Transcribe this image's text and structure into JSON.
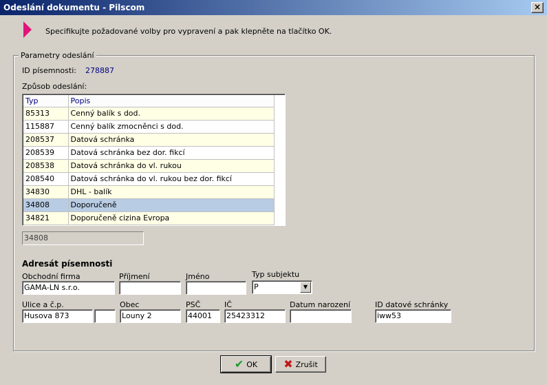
{
  "window": {
    "title": "Odeslání dokumentu - Pilscom",
    "close_label": "×"
  },
  "hint": {
    "text": "Specifikujte požadované volby pro vypravení a pak klepněte na tlačítko OK."
  },
  "group": {
    "legend": "Parametry odeslání"
  },
  "document": {
    "id_label": "ID písemnosti:",
    "id_value": "278887"
  },
  "method": {
    "label": "Způsob odeslání:",
    "columns": [
      "Typ",
      "Popis"
    ],
    "rows": [
      {
        "typ": "85313",
        "popis": "Cenný balík s dod."
      },
      {
        "typ": "115887",
        "popis": "Cenný balík zmocněnci s dod."
      },
      {
        "typ": "208537",
        "popis": "Datová schránka"
      },
      {
        "typ": "208539",
        "popis": "Datová schránka bez dor. fikcí"
      },
      {
        "typ": "208538",
        "popis": "Datová schránka do vl. rukou"
      },
      {
        "typ": "208540",
        "popis": "Datová schránka do vl. rukou bez dor. fikcí"
      },
      {
        "typ": "34830",
        "popis": "DHL - balík"
      },
      {
        "typ": "34808",
        "popis": "Doporučeně"
      },
      {
        "typ": "34821",
        "popis": "Doporučeně cizina Evropa"
      }
    ],
    "selected_value": "34808"
  },
  "addressee": {
    "title": "Adresát písemnosti",
    "firm_label": "Obchodní firma",
    "firm_value": "GAMA-LN s.r.o.",
    "surname_label": "Příjmení",
    "surname_value": "",
    "name_label": "Jméno",
    "name_value": "",
    "subject_type_label": "Typ subjektu",
    "subject_type_value": "P",
    "street_label": "Ulice a č.p.",
    "street_value": "Husova 873",
    "street_number_value": "",
    "city_label": "Obec",
    "city_value": "Louny 2",
    "zip_label": "PSČ",
    "zip_value": "44001",
    "ic_label": "IČ",
    "ic_value": "25423312",
    "birth_label": "Datum narození",
    "birth_value": "",
    "databox_label": "ID datové schránky",
    "databox_value": "iww53"
  },
  "buttons": {
    "ok_label": "OK",
    "cancel_label": "Zrušit"
  },
  "colors": {
    "selected_row": "#b8cce4",
    "odd_row": "#ffffe6",
    "accent_arrow": "#e0147a"
  }
}
